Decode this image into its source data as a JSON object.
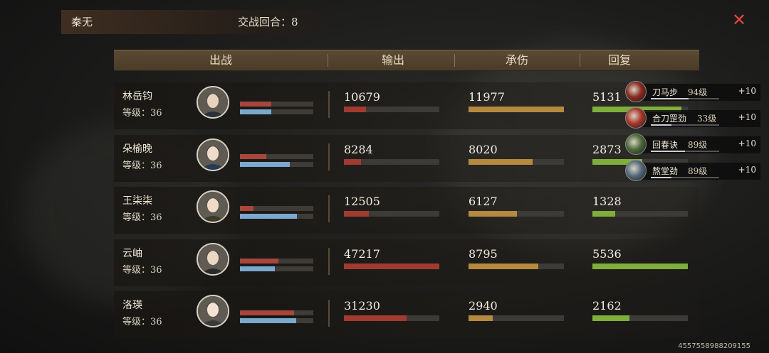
{
  "top": {
    "player_name": "秦无",
    "round_label": "交战回合：8",
    "close_symbol": "✕"
  },
  "header": {
    "columns": [
      "出战",
      "输出",
      "承伤",
      "回复"
    ]
  },
  "colors": {
    "damage_fill": "#a23a31",
    "taken_fill": "#b58a3e",
    "heal_fill": "#7fae3a",
    "mini_red": "#a9463b",
    "mini_blue": "#7aa8cf",
    "close": "#e0473d"
  },
  "heroes": [
    {
      "name": "林岳钧",
      "level": "等级：36",
      "avatar_icon": "male-swordsman-portrait",
      "hp_frac": 0.43,
      "mp_frac": 0.43,
      "damage": "10679",
      "damage_frac": 0.23,
      "taken": "11977",
      "taken_frac": 1.0,
      "heal": "5131",
      "heal_frac": 0.93
    },
    {
      "name": "朵榆晚",
      "level": "等级：36",
      "avatar_icon": "female-portrait-blue-robe",
      "hp_frac": 0.36,
      "mp_frac": 0.68,
      "damage": "8284",
      "damage_frac": 0.18,
      "taken": "8020",
      "taken_frac": 0.67,
      "heal": "2873",
      "heal_frac": 0.52
    },
    {
      "name": "王柒柒",
      "level": "等级：36",
      "avatar_icon": "female-portrait-flower-hair",
      "hp_frac": 0.18,
      "mp_frac": 0.78,
      "damage": "12505",
      "damage_frac": 0.26,
      "taken": "6127",
      "taken_frac": 0.51,
      "heal": "1328",
      "heal_frac": 0.24
    },
    {
      "name": "云岫",
      "level": "等级：36",
      "avatar_icon": "female-portrait-dark-hair",
      "hp_frac": 0.52,
      "mp_frac": 0.48,
      "damage": "47217",
      "damage_frac": 1.0,
      "taken": "8795",
      "taken_frac": 0.73,
      "heal": "5536",
      "heal_frac": 1.0
    },
    {
      "name": "洛瑛",
      "level": "等级：36",
      "avatar_icon": "female-portrait-white-robe",
      "hp_frac": 0.74,
      "mp_frac": 0.77,
      "damage": "31230",
      "damage_frac": 0.66,
      "taken": "2940",
      "taken_frac": 0.25,
      "heal": "2162",
      "heal_frac": 0.39
    }
  ],
  "skills": [
    {
      "name": "刀马步",
      "level": "94级",
      "bonus": "+10",
      "icon": "blade-skill-icon",
      "icon_color": "#8a2a22",
      "progress": 0.55
    },
    {
      "name": "合刀罡劲",
      "level": "33级",
      "bonus": "+10",
      "icon": "saber-aura-icon",
      "icon_color": "#a8382b",
      "progress": 0.3
    },
    {
      "name": "回春诀",
      "level": "89级",
      "bonus": "+10",
      "icon": "healing-skill-icon",
      "icon_color": "#4d6a3c",
      "progress": 0.5
    },
    {
      "name": "熬堂劲",
      "level": "89级",
      "bonus": "+10",
      "icon": "swirl-skill-icon",
      "icon_color": "#566b7c",
      "progress": 0.3
    }
  ],
  "uid": "4557558988209155"
}
